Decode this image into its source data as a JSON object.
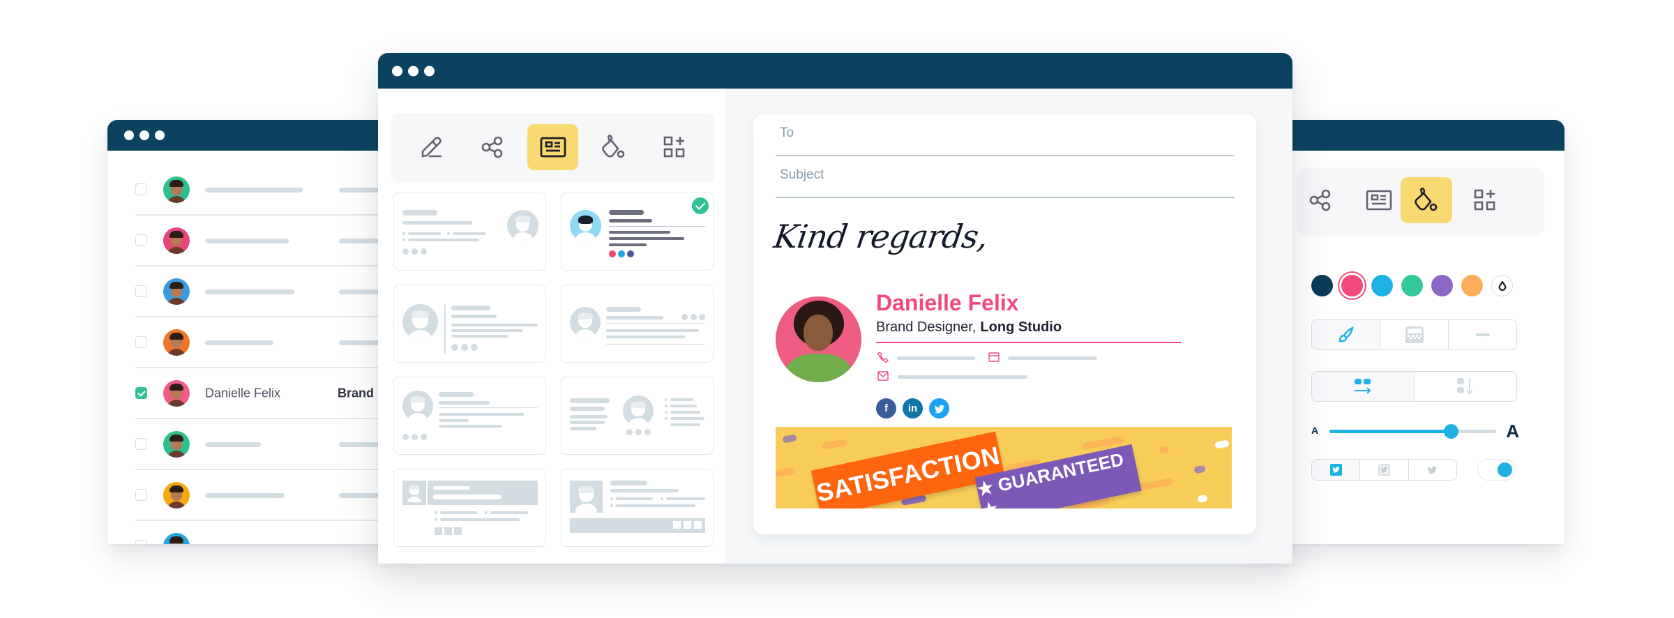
{
  "left_window": {
    "contacts": [
      {
        "avatar_color": "#2fbf8e",
        "name": "",
        "role": "",
        "checked": false
      },
      {
        "avatar_color": "#e8457a",
        "name": "",
        "role": "",
        "checked": false
      },
      {
        "avatar_color": "#3a9be0",
        "name": "",
        "role": "",
        "checked": false
      },
      {
        "avatar_color": "#f27429",
        "name": "",
        "role": "",
        "checked": false
      },
      {
        "avatar_color": "#ee5c82",
        "name": "Danielle Felix",
        "role": "Brand Designer",
        "checked": true
      },
      {
        "avatar_color": "#2fbf8e",
        "name": "",
        "role": "",
        "checked": false
      },
      {
        "avatar_color": "#f5a810",
        "name": "",
        "role": "",
        "checked": false
      },
      {
        "avatar_color": "#26a5dc",
        "name": "",
        "role": "",
        "checked": false
      }
    ]
  },
  "center_window": {
    "toolbar": {
      "tools": [
        {
          "icon": "pencil-icon",
          "active": false
        },
        {
          "icon": "share-icon",
          "active": false
        },
        {
          "icon": "id-card-icon",
          "active": true
        },
        {
          "icon": "paint-bucket-icon",
          "active": false
        },
        {
          "icon": "add-widget-icon",
          "active": false
        }
      ]
    },
    "templates": {
      "count": 8,
      "selected_index": 1
    },
    "email": {
      "to_label": "To",
      "subject_label": "Subject",
      "closing": "Kind regards,",
      "signature": {
        "name": "Danielle Felix",
        "title": "Brand Designer,",
        "company": "Long Studio",
        "accent_color": "#f2497b",
        "contact_icons": [
          "phone-icon",
          "website-icon",
          "email-icon"
        ],
        "social": [
          {
            "icon": "facebook-icon",
            "glyph": "f",
            "color": "#3b5a9a"
          },
          {
            "icon": "linkedin-icon",
            "glyph": "in",
            "color": "#0e76a8"
          },
          {
            "icon": "twitter-icon",
            "glyph": "t",
            "color": "#1da1f2"
          }
        ]
      },
      "banner": {
        "line1": "SATISFACTION",
        "line2": "★ GUARANTEED ★"
      }
    }
  },
  "right_window": {
    "toolbar": {
      "tools": [
        {
          "icon": "share-icon",
          "active": false
        },
        {
          "icon": "id-card-icon",
          "active": false
        },
        {
          "icon": "paint-bucket-icon",
          "active": true
        },
        {
          "icon": "add-widget-icon",
          "active": false
        }
      ]
    },
    "colors": [
      "#0b3b5a",
      "#f24a7c",
      "#1fb0e4",
      "#33c99a",
      "#8c68c6",
      "#fdac5c"
    ],
    "selected_color_index": 1,
    "divider_style_options": [
      "brush-icon",
      "pattern-icon",
      "line-icon"
    ],
    "layout_options": [
      "horizontal-layout-icon",
      "vertical-layout-icon"
    ],
    "font_size_small_label": "A",
    "font_size_large_label": "A",
    "font_size_value": 0.73,
    "social_icon_style_options": [
      "twitter-square-filled-icon",
      "twitter-square-outline-icon",
      "twitter-plain-icon"
    ],
    "toggle_on": true
  }
}
